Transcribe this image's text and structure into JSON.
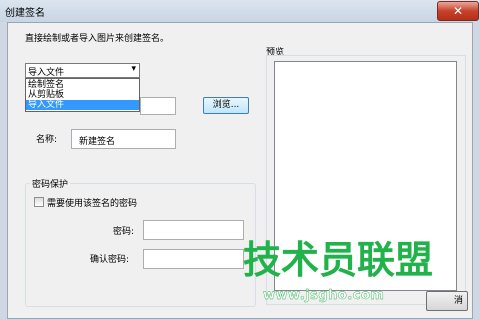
{
  "window": {
    "title": "创建签名",
    "close_glyph": "✕"
  },
  "instruction": "直接绘制或者导入图片来创建签名。",
  "source_combo": {
    "selected": "导入文件",
    "arrow": "▾",
    "options": [
      "绘制签名",
      "从剪贴板",
      "导入文件"
    ]
  },
  "browse_button": "浏览...",
  "name": {
    "label": "名称:",
    "value": "新建签名"
  },
  "password_group": {
    "title": "密码保护",
    "checkbox_label": "需要使用该签名的密码",
    "checked": false,
    "password_label": "密码:",
    "confirm_label": "确认密码:"
  },
  "preview": {
    "label": "预览"
  },
  "cancel_button": "消",
  "watermark": {
    "logo_text": "技术员联盟",
    "url": "www.jsgho.com",
    "color": "#21b24b"
  }
}
